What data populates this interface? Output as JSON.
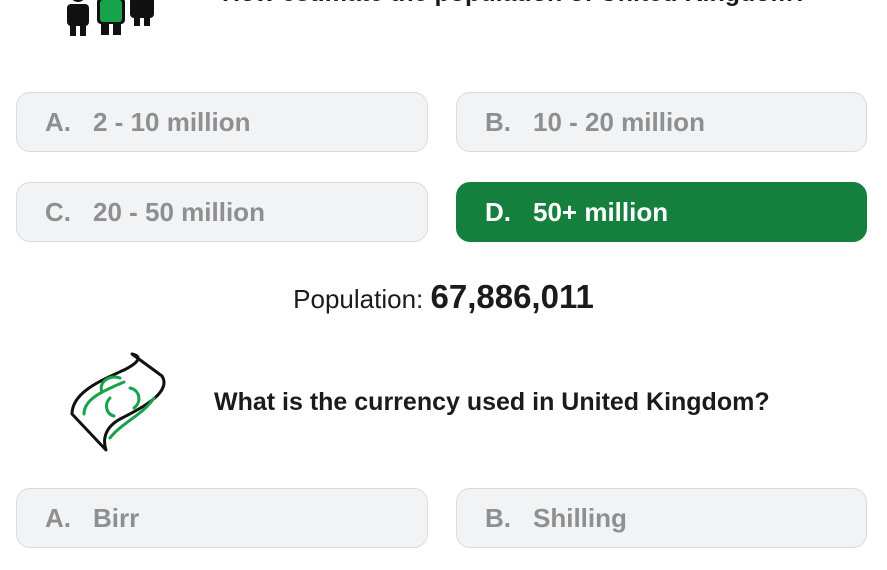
{
  "question1": {
    "text": "How estimate the population of United Kingdom?",
    "icon": "people-icon",
    "options": [
      {
        "letter": "A.",
        "label": "2 - 10 million",
        "correct": false
      },
      {
        "letter": "B.",
        "label": "10 - 20 million",
        "correct": false
      },
      {
        "letter": "C.",
        "label": "20 - 50 million",
        "correct": false
      },
      {
        "letter": "D.",
        "label": "50+ million",
        "correct": true
      }
    ]
  },
  "population": {
    "label": "Population:",
    "value": "67,886,011"
  },
  "question2": {
    "text": "What is the currency used in United Kingdom?",
    "icon": "banknote-icon",
    "options": [
      {
        "letter": "A.",
        "label": "Birr"
      },
      {
        "letter": "B.",
        "label": "Shilling"
      }
    ]
  },
  "colors": {
    "correct": "#15803d",
    "option_bg": "#f1f3f5",
    "option_text": "#8f8f8f",
    "icon_green": "#16a34a"
  }
}
